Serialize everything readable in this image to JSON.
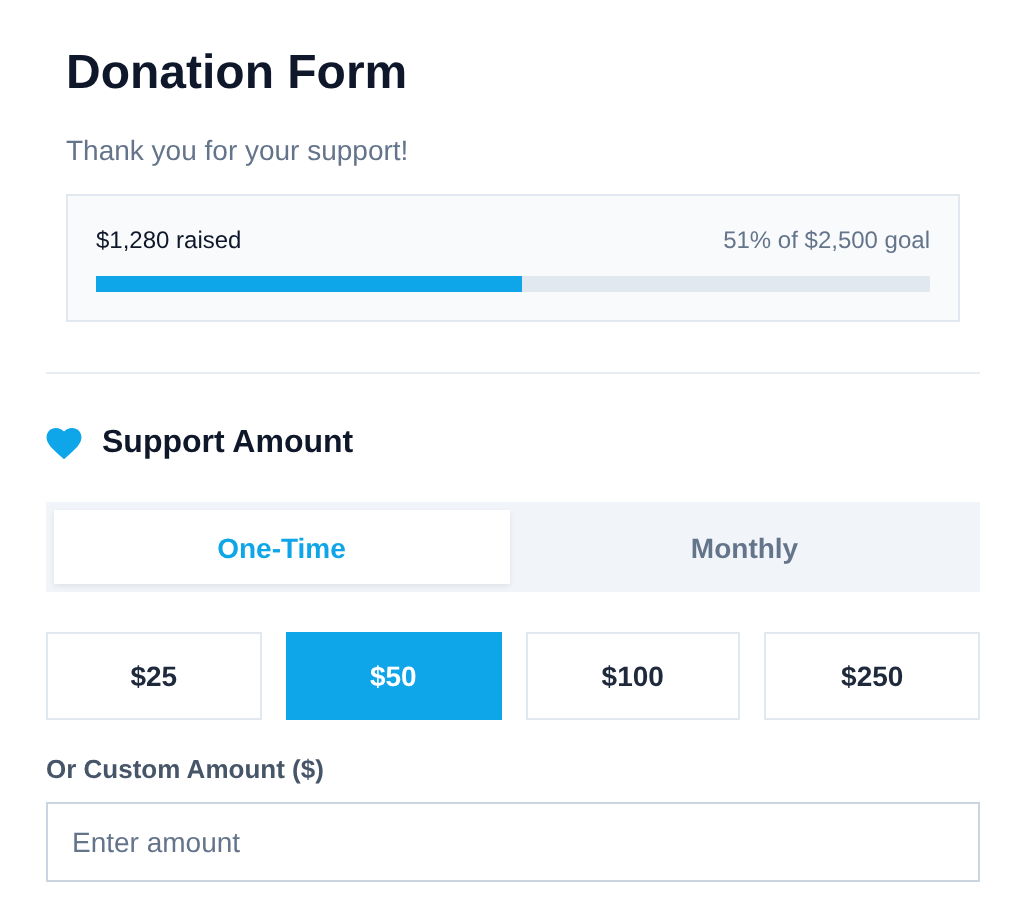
{
  "title": "Donation Form",
  "subtitle": "Thank you for your support!",
  "progress": {
    "raised": "$1,280 raised",
    "goal": "51% of $2,500 goal",
    "level": 0.51
  },
  "section": {
    "title": "Support Amount"
  },
  "tabs": [
    {
      "label": "One-Time",
      "selected": true
    },
    {
      "label": "Monthly",
      "selected": false
    }
  ],
  "amounts": [
    {
      "label": "$25",
      "selected": false
    },
    {
      "label": "$50",
      "selected": true
    },
    {
      "label": "$100",
      "selected": false
    },
    {
      "label": "$250",
      "selected": false
    }
  ],
  "custom": {
    "label": "Or Custom Amount ($)",
    "placeholder": "Enter amount"
  }
}
